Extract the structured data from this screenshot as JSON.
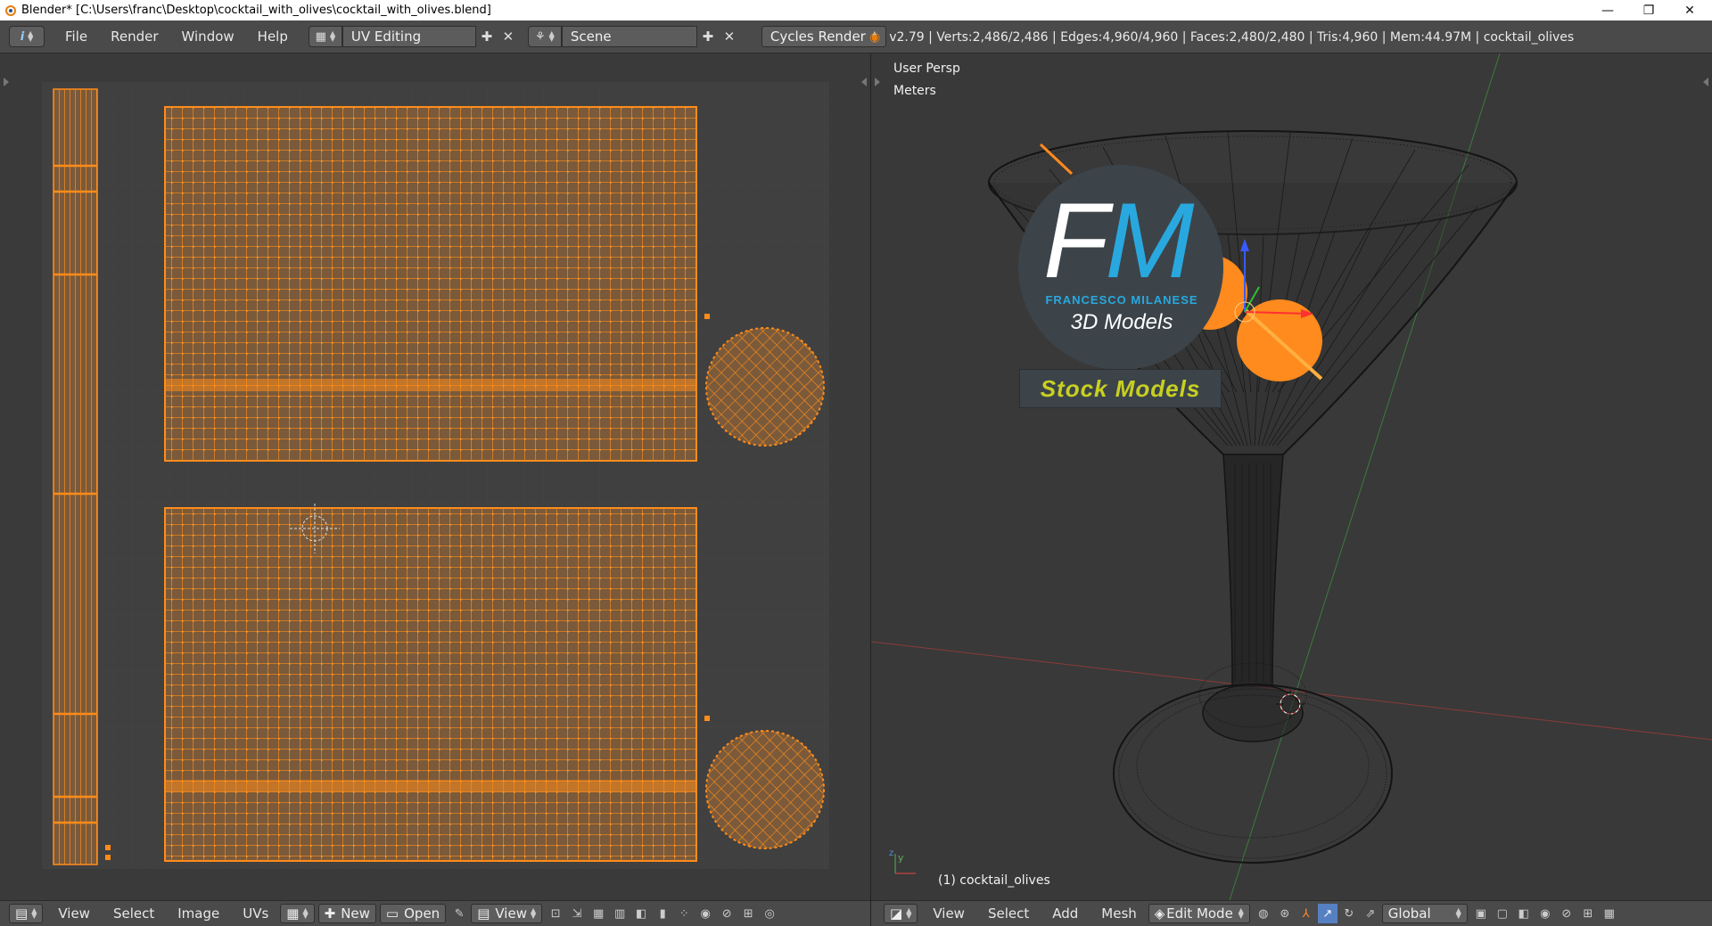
{
  "window": {
    "title": "Blender* [C:\\Users\\franc\\Desktop\\cocktail_with_olives\\cocktail_with_olives.blend]",
    "minimize": "—",
    "maximize": "❐",
    "close": "✕"
  },
  "topbar": {
    "info_icon": "i",
    "menus": [
      "File",
      "Render",
      "Window",
      "Help"
    ],
    "screen_layout": "UV Editing",
    "scene": "Scene",
    "render_engine": "Cycles Render",
    "stats": "v2.79 | Verts:2,486/2,486 | Edges:4,960/4,960 | Faces:2,480/2,480 | Tris:4,960 | Mem:44.97M | cocktail_olives"
  },
  "uv_editor": {
    "menus": [
      "View",
      "Select",
      "Image",
      "UVs"
    ],
    "new_label": "New",
    "open_label": "Open",
    "view_label": "View"
  },
  "viewport": {
    "view_name": "User Persp",
    "units": "Meters",
    "object_label": "(1) cocktail_olives",
    "menus": [
      "View",
      "Select",
      "Add",
      "Mesh"
    ],
    "mode": "Edit Mode",
    "orientation": "Global"
  },
  "watermark": {
    "letters_f": "F",
    "letters_m": "M",
    "name": "FRANCESCO MILANESE",
    "subtitle": "3D Models",
    "badge": "Stock Models"
  },
  "colors": {
    "uv_orange": "#ff8c1a",
    "uv_fill": "#7a5a3a",
    "grid": "#474747",
    "accent_blue": "#29a8df",
    "badge_text": "#c8d020"
  }
}
